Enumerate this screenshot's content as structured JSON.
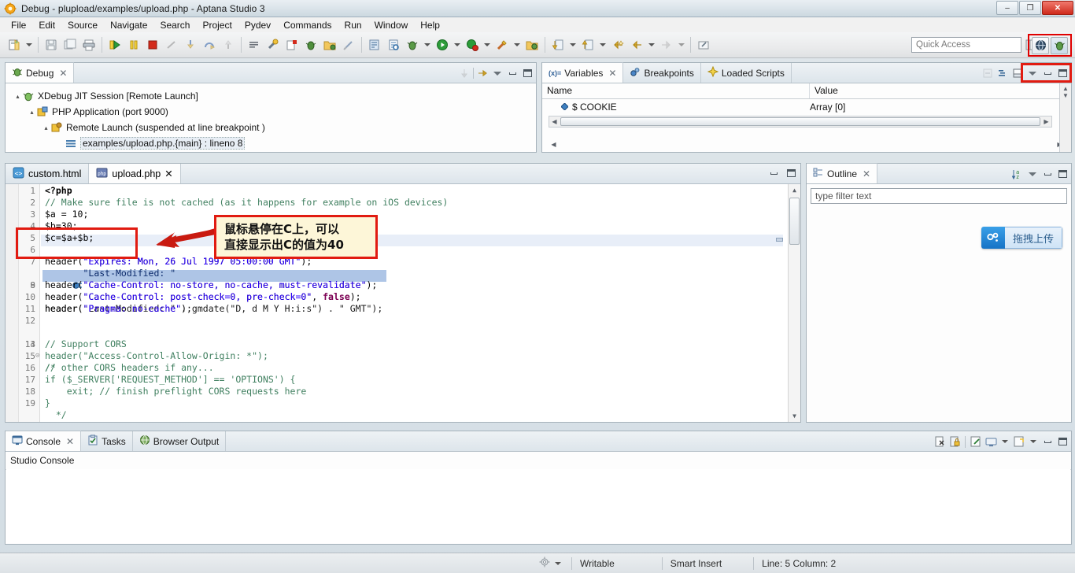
{
  "window": {
    "title": "Debug - plupload/examples/upload.php - Aptana Studio 3",
    "app_icon": "aptana-icon",
    "minimize_label": "–",
    "maximize_label": "❐",
    "close_label": "✕"
  },
  "menu": {
    "items": [
      {
        "label": "File",
        "mnemonic": "F"
      },
      {
        "label": "Edit",
        "mnemonic": "E"
      },
      {
        "label": "Source",
        "mnemonic": "S"
      },
      {
        "label": "Navigate",
        "mnemonic": "N"
      },
      {
        "label": "Search",
        "mnemonic": "a"
      },
      {
        "label": "Project",
        "mnemonic": "P"
      },
      {
        "label": "Pydev",
        "mnemonic": "y"
      },
      {
        "label": "Commands",
        "mnemonic": "C"
      },
      {
        "label": "Run",
        "mnemonic": "R"
      },
      {
        "label": "Window",
        "mnemonic": "W"
      },
      {
        "label": "Help",
        "mnemonic": "H"
      }
    ]
  },
  "toolbar": {
    "buttons": [
      {
        "name": "new-wizard-icon",
        "glyph": "🗎"
      },
      {
        "name": "new-dropdown-caret",
        "glyph": "▾"
      },
      {
        "name": "save-icon",
        "glyph": "💾"
      },
      {
        "name": "save-all-icon",
        "glyph": "🖫"
      },
      {
        "name": "print-icon",
        "glyph": "🖨"
      },
      {
        "name": "resume-icon",
        "glyph": "▶"
      },
      {
        "name": "suspend-icon",
        "glyph": "⏸"
      },
      {
        "name": "terminate-icon",
        "glyph": "■"
      },
      {
        "name": "disconnect-icon",
        "glyph": "✂"
      },
      {
        "name": "step-into-icon",
        "glyph": "↓"
      },
      {
        "name": "step-over-icon",
        "glyph": "↷"
      },
      {
        "name": "step-return-icon",
        "glyph": "↑"
      },
      {
        "name": "toggle-mark-occurrences-icon",
        "glyph": "≡"
      },
      {
        "name": "build-icon",
        "glyph": "🔨"
      },
      {
        "name": "error-marker-icon",
        "glyph": "⚠"
      },
      {
        "name": "debug-perspective-icon",
        "glyph": "🐞"
      },
      {
        "name": "open-folder-icon",
        "glyph": "📂"
      },
      {
        "name": "pencil-strike-icon",
        "glyph": "✐"
      },
      {
        "name": "open-type-icon",
        "glyph": "🗂"
      },
      {
        "name": "open-resource-icon",
        "glyph": "📄"
      },
      {
        "name": "debug-icon",
        "glyph": "🐞"
      },
      {
        "name": "debug-caret",
        "glyph": "▾"
      },
      {
        "name": "run-icon",
        "glyph": "▶"
      },
      {
        "name": "run-caret",
        "glyph": "▾"
      },
      {
        "name": "coverage-icon",
        "glyph": "●"
      },
      {
        "name": "coverage-caret",
        "glyph": "▾"
      },
      {
        "name": "external-tools-icon",
        "glyph": "🔧"
      },
      {
        "name": "external-tools-caret",
        "glyph": "▾"
      },
      {
        "name": "deploy-icon",
        "glyph": "📦"
      },
      {
        "name": "next-annotation-icon",
        "glyph": "⬇"
      },
      {
        "name": "next-annotation-caret",
        "glyph": "▾"
      },
      {
        "name": "previous-annotation-icon",
        "glyph": "⬆"
      },
      {
        "name": "previous-annotation-caret",
        "glyph": "▾"
      },
      {
        "name": "last-edit-location-icon",
        "glyph": "↩"
      },
      {
        "name": "back-icon",
        "glyph": "⬅"
      },
      {
        "name": "back-caret",
        "glyph": "▾"
      },
      {
        "name": "forward-icon",
        "glyph": "➡"
      },
      {
        "name": "forward-caret",
        "glyph": "▾"
      },
      {
        "name": "pin-editor-icon",
        "glyph": "📎"
      }
    ],
    "quick_access_placeholder": "Quick Access",
    "quick_access_value": "",
    "perspective_buttons": [
      {
        "name": "web-perspective-icon",
        "glyph": "🌐"
      },
      {
        "name": "debug-perspective-active-icon",
        "glyph": "🐞"
      }
    ],
    "open_perspective_icon": "open-perspective-icon"
  },
  "debug_view": {
    "tab_label": "Debug",
    "tab_icon": "debug-bug-icon",
    "tools": [
      {
        "name": "view-menu-icon",
        "glyph": "▽"
      },
      {
        "name": "minimize-icon",
        "glyph": "–"
      },
      {
        "name": "maximize-icon",
        "glyph": "❐"
      }
    ],
    "tree": [
      {
        "indent": 0,
        "arrow": "▴",
        "icon": "xdebug-session-icon",
        "label": "XDebug JIT Session [Remote Launch]",
        "selected": false
      },
      {
        "indent": 1,
        "arrow": "▴",
        "icon": "php-application-icon",
        "label": "PHP Application (port 9000)",
        "selected": false
      },
      {
        "indent": 2,
        "arrow": "▴",
        "icon": "remote-launch-icon",
        "label": "Remote Launch (suspended at line breakpoint )",
        "selected": false
      },
      {
        "indent": 3,
        "arrow": "",
        "icon": "stack-frame-icon",
        "label": "examples/upload.php.{main} : lineno 8",
        "selected": true
      }
    ]
  },
  "variables_view": {
    "tabs": [
      {
        "label": "Variables",
        "icon": "variables-icon",
        "active": true,
        "closable": true
      },
      {
        "label": "Breakpoints",
        "icon": "breakpoints-icon",
        "active": false,
        "closable": false
      },
      {
        "label": "Loaded Scripts",
        "icon": "loaded-scripts-icon",
        "active": false,
        "closable": false
      }
    ],
    "tools": [
      {
        "name": "show-logical-structure-icon",
        "glyph": "⊞"
      },
      {
        "name": "collapse-all-icon",
        "glyph": "≡"
      },
      {
        "name": "view-menu-icon",
        "glyph": "▽"
      },
      {
        "name": "minimize-icon",
        "glyph": "–"
      },
      {
        "name": "maximize-icon",
        "glyph": "❐"
      }
    ],
    "columns": [
      "Name",
      "Value"
    ],
    "rows": [
      {
        "icon": "variable-marker-icon",
        "name": "$ COOKIE",
        "value": "Array [0]"
      }
    ]
  },
  "editor": {
    "tabs": [
      {
        "label": "custom.html",
        "icon": "html-file-icon",
        "active": false,
        "closable": false
      },
      {
        "label": "upload.php",
        "icon": "php-file-icon",
        "active": true,
        "closable": true
      }
    ],
    "tools": [
      {
        "name": "restore-icon",
        "glyph": "–"
      },
      {
        "name": "maximize-icon",
        "glyph": "❐"
      }
    ],
    "lines": [
      {
        "num": "1",
        "fold": "",
        "breakpoint": false,
        "highlight": "none",
        "text": "<?php",
        "style": "php"
      },
      {
        "num": "2",
        "fold": "",
        "breakpoint": false,
        "highlight": "none",
        "text": "// Make sure file is not cached (as it happens for example on iOS devices)",
        "style": "comment"
      },
      {
        "num": "3",
        "fold": "",
        "breakpoint": false,
        "highlight": "none",
        "text": "$a = 10;",
        "style": "code"
      },
      {
        "num": "4",
        "fold": "",
        "breakpoint": false,
        "highlight": "none",
        "text": "$b=30;",
        "style": "code"
      },
      {
        "num": "5",
        "fold": "",
        "breakpoint": false,
        "highlight": "caret",
        "text": "$c=$a+$b;",
        "style": "code"
      },
      {
        "num": "6",
        "fold": "",
        "breakpoint": false,
        "highlight": "none",
        "text": "",
        "style": "code"
      },
      {
        "num": "7",
        "fold": "",
        "breakpoint": false,
        "highlight": "none",
        "text": "header(\"Expires: Mon, 26 Jul 1997 05:00:00 GMT\");",
        "style": "header"
      },
      {
        "num": "8",
        "fold": "",
        "breakpoint": true,
        "highlight": "selected",
        "text": "header(\"Last-Modified: \" . gmdate(\"D, d M Y H:i:s\") . \" GMT\");",
        "style": "header"
      },
      {
        "num": "9",
        "fold": "",
        "breakpoint": false,
        "highlight": "none",
        "text": "header(\"Cache-Control: no-store, no-cache, must-revalidate\");",
        "style": "header"
      },
      {
        "num": "10",
        "fold": "",
        "breakpoint": false,
        "highlight": "none",
        "text": "header(\"Cache-Control: post-check=0, pre-check=0\", false);",
        "style": "header"
      },
      {
        "num": "11",
        "fold": "",
        "breakpoint": false,
        "highlight": "none",
        "text": "header(\"Pragma: no-cache\");",
        "style": "header"
      },
      {
        "num": "12",
        "fold": "",
        "breakpoint": false,
        "highlight": "none",
        "text": "",
        "style": "code"
      },
      {
        "num": "13",
        "fold": "⊝",
        "breakpoint": false,
        "highlight": "none",
        "text": "/*",
        "style": "comment"
      },
      {
        "num": "14",
        "fold": "",
        "breakpoint": false,
        "highlight": "none",
        "text": "// Support CORS",
        "style": "comment"
      },
      {
        "num": "15",
        "fold": "",
        "breakpoint": false,
        "highlight": "none",
        "text": "header(\"Access-Control-Allow-Origin: *\");",
        "style": "comment"
      },
      {
        "num": "16",
        "fold": "",
        "breakpoint": false,
        "highlight": "none",
        "text": "// other CORS headers if any...",
        "style": "comment"
      },
      {
        "num": "17",
        "fold": "",
        "breakpoint": false,
        "highlight": "none",
        "text": "if ($_SERVER['REQUEST_METHOD'] == 'OPTIONS') {",
        "style": "comment"
      },
      {
        "num": "18",
        "fold": "",
        "breakpoint": false,
        "highlight": "none",
        "text": "    exit; // finish preflight CORS requests here",
        "style": "comment"
      },
      {
        "num": "19",
        "fold": "",
        "breakpoint": false,
        "highlight": "none",
        "text": "}",
        "style": "comment"
      },
      {
        "num": "",
        "fold": "",
        "breakpoint": false,
        "highlight": "none",
        "text": "  */",
        "style": "comment"
      }
    ]
  },
  "outline_view": {
    "tab_label": "Outline",
    "tab_icon": "outline-icon",
    "tools": [
      {
        "name": "sort-alphabetically-icon",
        "glyph": "a↓z"
      },
      {
        "name": "view-menu-icon",
        "glyph": "▽"
      },
      {
        "name": "minimize-icon",
        "glyph": "–"
      },
      {
        "name": "maximize-icon",
        "glyph": "❐"
      }
    ],
    "filter_placeholder": "type filter text",
    "filter_value": ""
  },
  "console_view": {
    "tabs": [
      {
        "label": "Console",
        "icon": "console-icon",
        "active": true,
        "closable": true
      },
      {
        "label": "Tasks",
        "icon": "tasks-icon",
        "active": false,
        "closable": false
      },
      {
        "label": "Browser Output",
        "icon": "browser-output-icon",
        "active": false,
        "closable": false
      }
    ],
    "tools": [
      {
        "name": "clear-console-icon",
        "glyph": "🗑"
      },
      {
        "name": "scroll-lock-icon",
        "glyph": "🔒"
      },
      {
        "name": "pin-console-icon",
        "glyph": "📌"
      },
      {
        "name": "display-selected-console-icon",
        "glyph": "🖥"
      },
      {
        "name": "display-selected-caret",
        "glyph": "▾"
      },
      {
        "name": "open-console-icon",
        "glyph": "🗒"
      },
      {
        "name": "open-console-caret",
        "glyph": "▾"
      },
      {
        "name": "minimize-icon",
        "glyph": "–"
      },
      {
        "name": "maximize-icon",
        "glyph": "❐"
      }
    ],
    "content_label": "Studio Console",
    "output": ""
  },
  "statusbar": {
    "settings_icon": "gear-icon",
    "settings_caret": "▾",
    "writable": "Writable",
    "insert_mode": "Smart Insert",
    "position": "Line: 5 Column: 2"
  },
  "annotations": {
    "callout_lines": [
      "鼠标悬停在C上，可以",
      "直接显示出C的值为40"
    ],
    "highlight_color": "#e11b11",
    "callout_bg": "#fdf6d8"
  },
  "overlay_widget": {
    "label": "拖拽上传",
    "icon": "upload-cloud-icon",
    "accent": "#1673c6"
  }
}
